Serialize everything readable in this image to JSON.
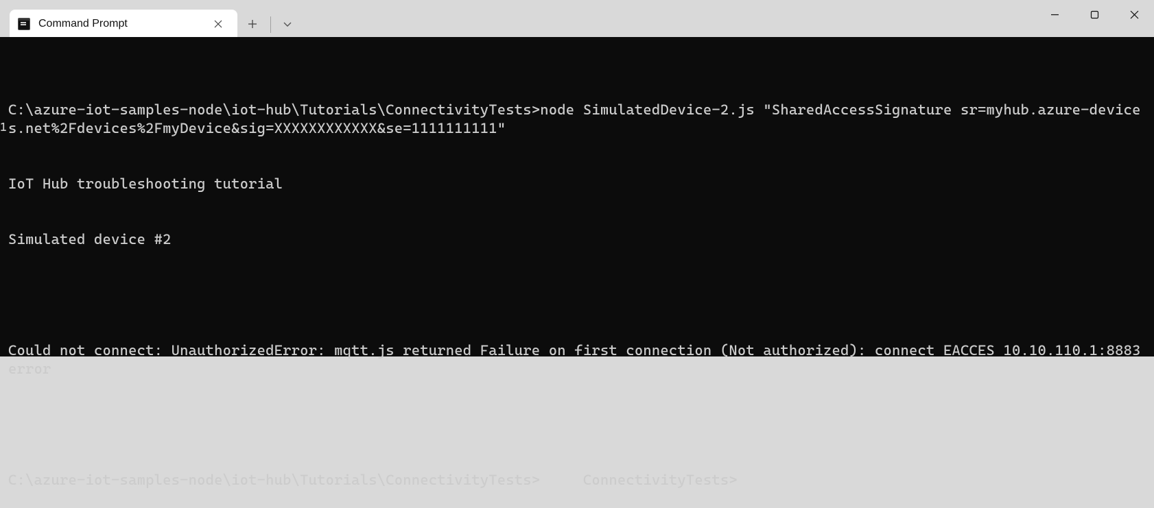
{
  "window": {
    "tab_title": "Command Prompt"
  },
  "terminal": {
    "lines": [
      "C:\\azure-iot-samples-node\\iot-hub\\Tutorials\\ConnectivityTests>node SimulatedDevice-2.js \"SharedAccessSignature sr=myhub.azure-devices.net%2Fdevices%2FmyDevice&sig=XXXXXXXXXXXX&se=1111111111\"",
      "IoT Hub troubleshooting tutorial",
      "Simulated device #2",
      "",
      "Could not connect: UnauthorizedError: mqtt.js returned Failure on first connection (Not authorized): connect EACCES 10.10.110.1:8883 error",
      "",
      "C:\\azure-iot-samples-node\\iot-hub\\Tutorials\\ConnectivityTests>     ConnectivityTests>"
    ],
    "side_marker": "1"
  }
}
